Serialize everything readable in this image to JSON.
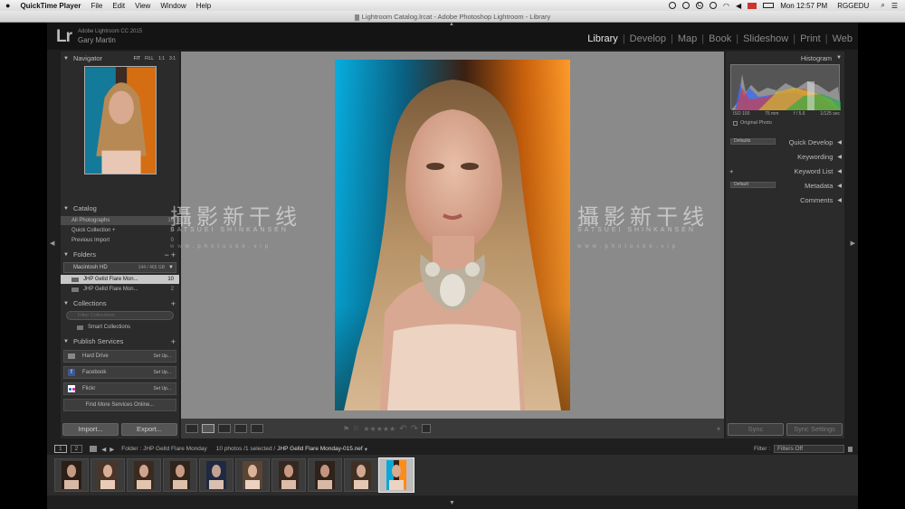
{
  "menubar": {
    "apple": "",
    "app": "QuickTime Player",
    "items": [
      "File",
      "Edit",
      "View",
      "Window",
      "Help"
    ],
    "clock": "Mon 12:57 PM",
    "user": "RGGEDU"
  },
  "window": {
    "title": "Lightroom Catalog.lrcat - Adobe Photoshop Lightroom - Library"
  },
  "identity": {
    "logo": "Lr",
    "version": "Adobe Lightroom CC 2015",
    "user": "Gary Martin"
  },
  "modules": [
    "Library",
    "Develop",
    "Map",
    "Book",
    "Slideshow",
    "Print",
    "Web"
  ],
  "navigator": {
    "title": "Navigator",
    "zoom": [
      "FIT",
      "FILL",
      "1:1",
      "3:1"
    ]
  },
  "catalog": {
    "title": "Catalog",
    "items": [
      {
        "label": "All Photographs",
        "count": "10"
      },
      {
        "label": "Quick Collection +",
        "count": "0"
      },
      {
        "label": "Previous Import",
        "count": "0"
      }
    ]
  },
  "folders": {
    "title": "Folders",
    "drive": "Macintosh HD",
    "drive_size": "144 / 465 GB",
    "items": [
      {
        "label": "JHP Gelld Flare Mon...",
        "count": "10"
      },
      {
        "label": "JHP Gelld Flare Mon...",
        "count": "2"
      }
    ]
  },
  "collections": {
    "title": "Collections",
    "filter": "Filter Collections",
    "smart": "Smart Collections"
  },
  "publish": {
    "title": "Publish Services",
    "services": [
      {
        "label": "Hard Drive",
        "action": "Set Up..."
      },
      {
        "label": "Facebook",
        "action": "Set Up..."
      },
      {
        "label": "Flickr",
        "action": "Set Up..."
      }
    ],
    "more": "Find More Services Online..."
  },
  "left_buttons": {
    "import": "Import...",
    "export": "Export..."
  },
  "histogram": {
    "title": "Histogram",
    "iso": "ISO 100",
    "focal": "75 mm",
    "aperture": "f / 5.6",
    "shutter": "1/125 sec",
    "original": "Original Photo"
  },
  "right_panels": [
    {
      "label": "Quick Develop",
      "preset": "Defaults"
    },
    {
      "label": "Keywording"
    },
    {
      "label": "Keyword List",
      "plus": "+"
    },
    {
      "label": "Metadata",
      "preset": "Default"
    },
    {
      "label": "Comments"
    }
  ],
  "right_buttons": {
    "sync": "Sync",
    "sync_settings": "Sync Settings"
  },
  "filmhead": {
    "page1": "1",
    "page2": "2",
    "folder": "Folder : JHP Gelld Flare Monday",
    "count": "10 photos /1 selected /",
    "file": "JHP Gelld Flare Monday-015.nef",
    "filter_label": "Filter :",
    "filter_value": "Filters Off"
  },
  "watermark": {
    "cn": "攝影新干线",
    "en": "SATSUEI SHINKANSEN",
    "url": "www.photoske.vip"
  },
  "colors": {
    "bg": "#1f1f1f",
    "panel": "#2b2b2b",
    "center": "#8a8a8a",
    "gel_cyan": "#0aa8d8",
    "gel_orange": "#ff8c1a"
  }
}
